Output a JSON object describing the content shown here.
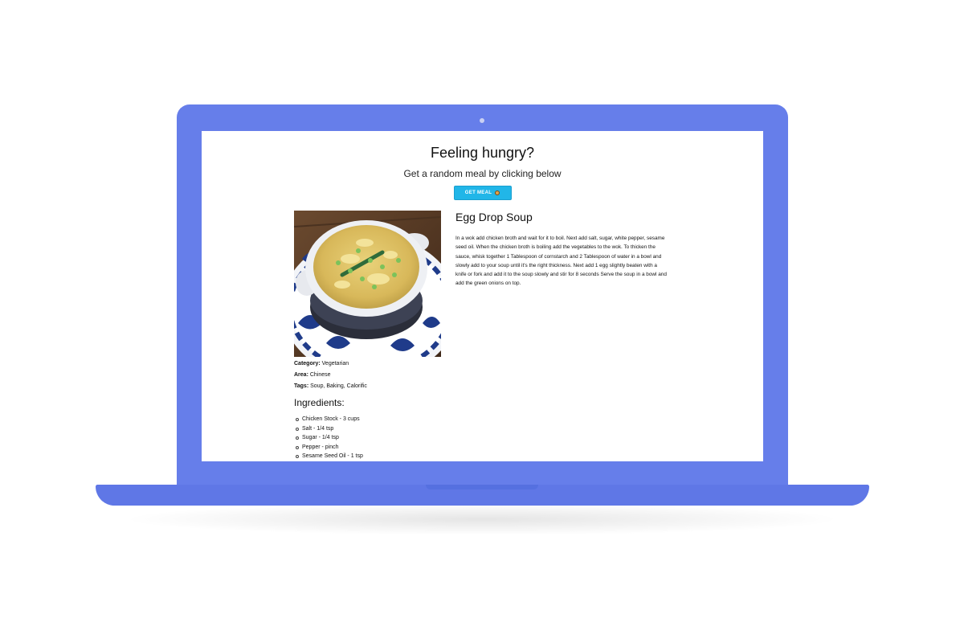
{
  "hero": {
    "title": "Feeling hungry?",
    "subtitle": "Get a random meal by clicking below",
    "button_label": "GET MEAL",
    "button_emoji_icon": "cookie-emoji-icon"
  },
  "meal": {
    "name": "Egg Drop Soup",
    "photo_alt": "Egg Drop Soup",
    "category_label": "Category:",
    "category": "Vegetarian",
    "area_label": "Area:",
    "area": "Chinese",
    "tags_label": "Tags:",
    "tags": "Soup, Baking, Calorific",
    "instructions": "In a wok add chicken broth and wait for it to boil. Next add salt, sugar, white pepper, sesame seed oil. When the chicken broth is boiling add the vegetables to the wok. To thicken the sauce, whisk together 1 Tablespoon of cornstarch and 2 Tablespoon of water in a bowl and slowly add to your soup until it's the right thickness. Next add 1 egg slightly beaten with a knife or fork and add it to the soup slowly and stir for 8 seconds Serve the soup in a bowl and add the green onions on top."
  },
  "ingredients": {
    "title": "Ingredients:",
    "items": [
      "Chicken Stock - 3 cups",
      "Salt - 1/4 tsp",
      "Sugar - 1/4 tsp",
      "Pepper - pinch",
      "Sesame Seed Oil - 1 tsp"
    ]
  },
  "colors": {
    "laptop": "#667eea",
    "button": "#21b6e8"
  }
}
